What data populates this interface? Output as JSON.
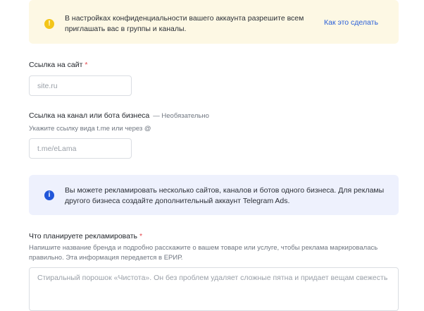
{
  "privacy_notice": {
    "icon": "exclamation-icon",
    "text": "В настройках конфиденциальности вашего аккаунта разрешите всем приглашать вас в группы и каналы.",
    "link": "Как это сделать",
    "color": "#fdf8e4"
  },
  "site_field": {
    "label": "Ссылка на сайт",
    "required_mark": "*",
    "placeholder": "site.ru",
    "value": ""
  },
  "channel_field": {
    "label": "Ссылка на канал или бота бизнеса",
    "optional_mark": "— Необязательно",
    "hint": "Укажите ссылку вида t.me или через @",
    "placeholder": "t.me/eLama",
    "value": ""
  },
  "business_notice": {
    "icon": "info-icon",
    "text": "Вы можете рекламировать несколько сайтов, каналов и ботов одного бизнеса. Для рекламы другого бизнеса создайте дополнительный аккаунт Telegram Ads.",
    "color": "#eef1fd"
  },
  "promo_field": {
    "label": "Что планируете рекламировать",
    "required_mark": "*",
    "hint": "Напишите название бренда и подробно расскажите о вашем товаре или услуге, чтобы реклама маркировалась правильно. Эта информация передается в ЕРИР.",
    "placeholder": "Стиральный порошок «Чистота». Он без проблем удаляет сложные пятна и придает вещам свежесть",
    "value": ""
  },
  "colors": {
    "accent": "#2a5fd8",
    "required": "#e5484d",
    "warning": "#f3c518",
    "info": "#2156d9"
  }
}
